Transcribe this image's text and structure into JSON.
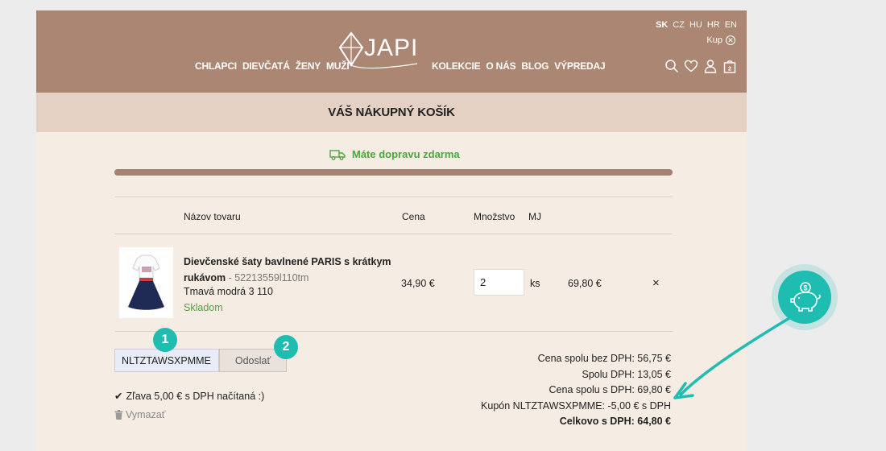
{
  "header": {
    "nav_left": [
      "CHLAPCI",
      "DIEVČATÁ",
      "ŽENY",
      "MUŽI"
    ],
    "nav_right": [
      "KOLEKCIE",
      "O NÁS",
      "BLOG",
      "VÝPREDAJ"
    ],
    "logo_text": "JAPI",
    "languages": [
      "SK",
      "CZ",
      "HU",
      "HR",
      "EN"
    ],
    "active_language": "SK",
    "kup_label": "Kup",
    "cart_count": "2",
    "icons": [
      "search-icon",
      "heart-icon",
      "user-icon",
      "cart-icon"
    ],
    "color": "#ab8672"
  },
  "cart": {
    "title": "VÁŠ NÁKUPNÝ KOŠÍK",
    "shipping_message": "Máte dopravu zdarma",
    "shipping_progress": 1.0,
    "columns": {
      "name": "Názov tovaru",
      "price": "Cena",
      "qty": "Množstvo",
      "unit": "MJ"
    },
    "item": {
      "name": "Dievčenské šaty bavlnené PARIS s krátkym rukávom",
      "code": "- 52213559l110tm",
      "variant": "Tmavá modrá 3 110",
      "stock": "Skladom",
      "price": "34,90 €",
      "quantity": "2",
      "unit": "ks",
      "total": "69,80 €",
      "remove_symbol": "×"
    },
    "coupon": {
      "value": "NLTZTAWSXPMME",
      "submit_label": "Odoslať",
      "discount_message": "Zľava 5,00  € s DPH načítaná :)",
      "clear_label": "Vymazať"
    },
    "summary": {
      "without_vat": "Cena spolu bez DPH: 56,75 €",
      "vat": "Spolu DPH: 13,05 €",
      "with_vat": "Cena spolu s DPH: 69,80 €",
      "coupon_line": "Kupón NLTZTAWSXPMME: -5,00  € s DPH",
      "grand_total": "Celkovo s DPH: 64,80 €"
    }
  },
  "annotations": {
    "badge_1": "1",
    "badge_2": "2",
    "accent": "#1fbcb2"
  }
}
